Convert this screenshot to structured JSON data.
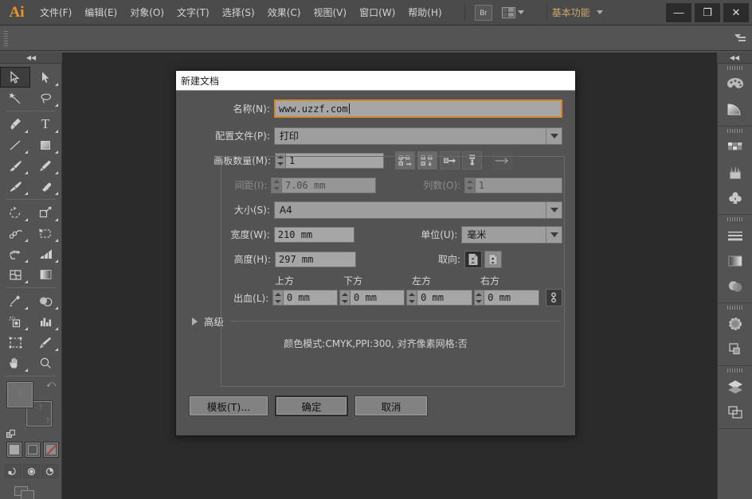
{
  "app": {
    "logo": "Ai"
  },
  "menubar": {
    "items": [
      {
        "label": "文件(F)",
        "name": "menu-file"
      },
      {
        "label": "编辑(E)",
        "name": "menu-edit"
      },
      {
        "label": "对象(O)",
        "name": "menu-object"
      },
      {
        "label": "文字(T)",
        "name": "menu-type"
      },
      {
        "label": "选择(S)",
        "name": "menu-select"
      },
      {
        "label": "效果(C)",
        "name": "menu-effect"
      },
      {
        "label": "视图(V)",
        "name": "menu-view"
      },
      {
        "label": "窗口(W)",
        "name": "menu-window"
      },
      {
        "label": "帮助(H)",
        "name": "menu-help"
      }
    ],
    "bridge_label": "Br",
    "workspace": "基本功能",
    "window_controls": {
      "minimize": "—",
      "maximize": "❐",
      "close": "✕"
    }
  },
  "dialog": {
    "title": "新建文档",
    "name_field": {
      "label": "名称(N):",
      "value": "www.uzzf.com"
    },
    "profile": {
      "label": "配置文件(P):",
      "value": "打印"
    },
    "artboards": {
      "label": "画板数量(M):",
      "value": "1"
    },
    "spacing": {
      "label": "间距(I):",
      "value": "7.06 mm"
    },
    "columns": {
      "label": "列数(O):",
      "value": "1"
    },
    "size": {
      "label": "大小(S):",
      "value": "A4"
    },
    "width": {
      "label": "宽度(W):",
      "value": "210 mm"
    },
    "height": {
      "label": "高度(H):",
      "value": "297 mm"
    },
    "units": {
      "label": "单位(U):",
      "value": "毫米"
    },
    "orientation": {
      "label": "取向:",
      "portrait_name": "portrait",
      "landscape_name": "landscape"
    },
    "bleed": {
      "label": "出血(L):",
      "heads": [
        "上方",
        "下方",
        "左方",
        "右方"
      ],
      "values": [
        "0 mm",
        "0 mm",
        "0 mm",
        "0 mm"
      ],
      "link_glyph": "⧉"
    },
    "advanced": {
      "label": "高级"
    },
    "summary": "颜色模式:CMYK,PPI:300, 对齐像素网格:否",
    "buttons": {
      "template": "模板(T)...",
      "ok": "确定",
      "cancel": "取消"
    }
  },
  "toolbar": {
    "tools": [
      "selection-tool",
      "direct-selection-tool",
      "magic-wand-tool",
      "lasso-tool",
      "pen-tool",
      "type-tool",
      "line-segment-tool",
      "rectangle-tool",
      "paintbrush-tool",
      "pencil-tool",
      "blob-brush-tool",
      "eraser-tool",
      "rotate-tool",
      "scale-tool",
      "width-tool",
      "free-transform-tool",
      "shape-builder-tool",
      "perspective-grid-tool",
      "mesh-tool",
      "gradient-tool",
      "eyedropper-tool",
      "blend-tool",
      "symbol-sprayer-tool",
      "column-graph-tool",
      "artboard-tool",
      "slice-tool",
      "hand-tool",
      "zoom-tool"
    ],
    "fill_stroke": {
      "fill_name": "fill-swatch",
      "stroke_name": "stroke-swatch"
    },
    "paint_modes": [
      "color-mode",
      "gradient-mode",
      "none-mode"
    ],
    "screen_modes": [
      "normal-screen-mode",
      "full-screen-menu-mode",
      "full-screen-mode"
    ]
  },
  "right_dock": {
    "groups": [
      {
        "icons": [
          "color-panel",
          "color-guide-panel"
        ]
      },
      {
        "icons": [
          "swatches-panel",
          "brushes-panel",
          "symbols-panel"
        ]
      },
      {
        "icons": [
          "stroke-panel",
          "gradient-panel",
          "transparency-panel"
        ]
      },
      {
        "icons": [
          "appearance-panel",
          "graphic-styles-panel"
        ]
      },
      {
        "icons": [
          "layers-panel",
          "artboards-panel"
        ]
      }
    ],
    "collapse_glyph": "◀◀"
  },
  "colors": {
    "app_bg": "#535353",
    "canvas_bg": "#2b2b2b",
    "accent_orange": "#d08a2c",
    "logo_orange": "#e8932b",
    "workspace_text": "#c9a86a"
  }
}
